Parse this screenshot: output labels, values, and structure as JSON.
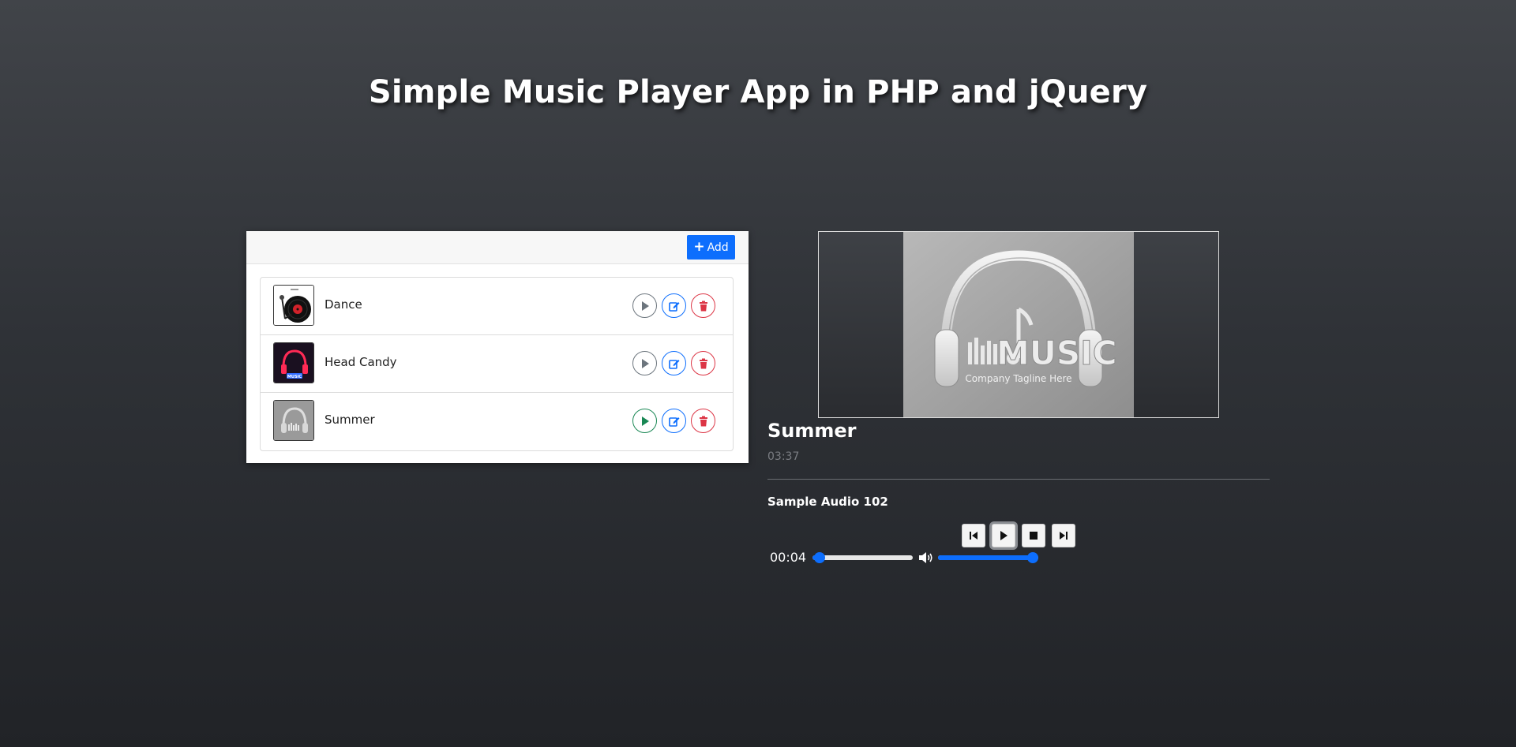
{
  "page": {
    "title": "Simple Music Player App in PHP and jQuery"
  },
  "playlist": {
    "header_title": "",
    "add_label": "Add",
    "tracks": [
      {
        "name": "Dance",
        "thumb": "vinyl-turntable-thumb"
      },
      {
        "name": "Head Candy",
        "thumb": "neon-headphones-thumb"
      },
      {
        "name": "Summer",
        "thumb": "music-headphones-logo-thumb"
      }
    ],
    "active_track_index": 2,
    "row_actions": [
      "play-icon",
      "edit-icon",
      "trash-icon"
    ]
  },
  "player": {
    "cover_art": "music-headphones-logo",
    "cover_logo_text": "MUSIC",
    "cover_tagline": "Company Tagline Here",
    "title": "Summer",
    "duration": "03:37",
    "artist": "Sample Audio 102",
    "current_time": "00:04",
    "progress_fraction": 0.02,
    "volume_fraction": 1.0,
    "controls": [
      "skip-back-icon",
      "play-icon",
      "stop-icon",
      "skip-forward-icon"
    ],
    "active_control": "play-icon"
  },
  "colors": {
    "primary": "#0d6efd",
    "success": "#198754",
    "danger": "#dc3545",
    "secondary": "#6c757d"
  }
}
